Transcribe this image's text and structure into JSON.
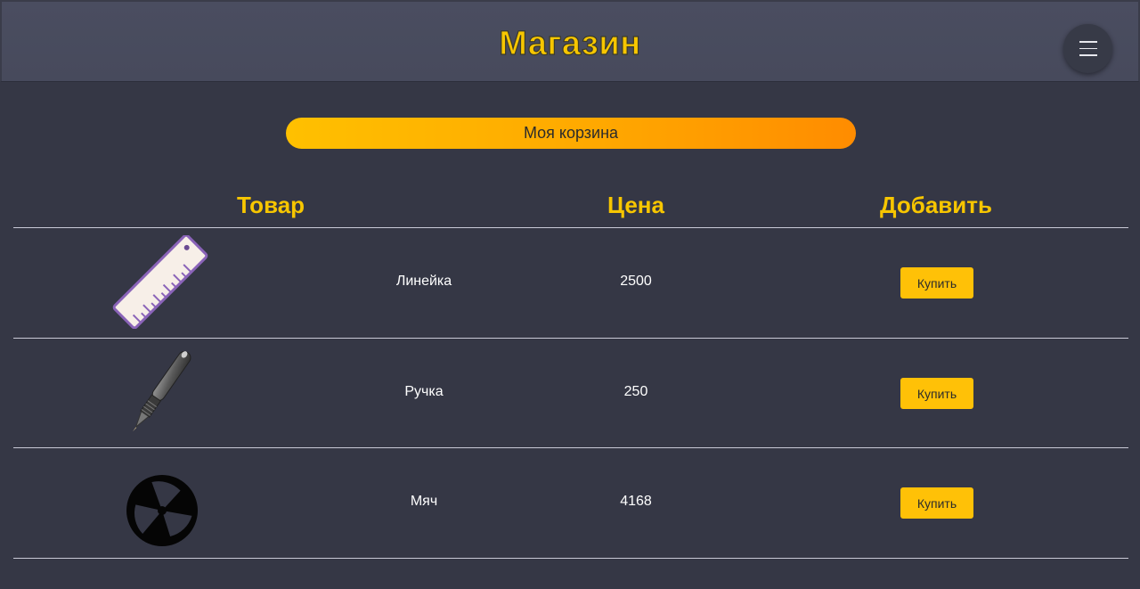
{
  "header": {
    "title": "Магазин",
    "menu_icon": "hamburger-icon"
  },
  "cart": {
    "label": "Моя корзина"
  },
  "table": {
    "columns": [
      "Товар",
      "Цена",
      "Добавить"
    ],
    "rows": [
      {
        "image": "ruler-icon",
        "name": "Линейка",
        "price": "2500",
        "button": "Купить"
      },
      {
        "image": "pen-icon",
        "name": "Ручка",
        "price": "250",
        "button": "Купить"
      },
      {
        "image": "ball-icon",
        "name": "Мяч",
        "price": "4168",
        "button": "Купить"
      }
    ]
  },
  "colors": {
    "background": "#353745",
    "header": "#4a4d60",
    "accent": "#f7c600",
    "button": "#ffc107"
  }
}
